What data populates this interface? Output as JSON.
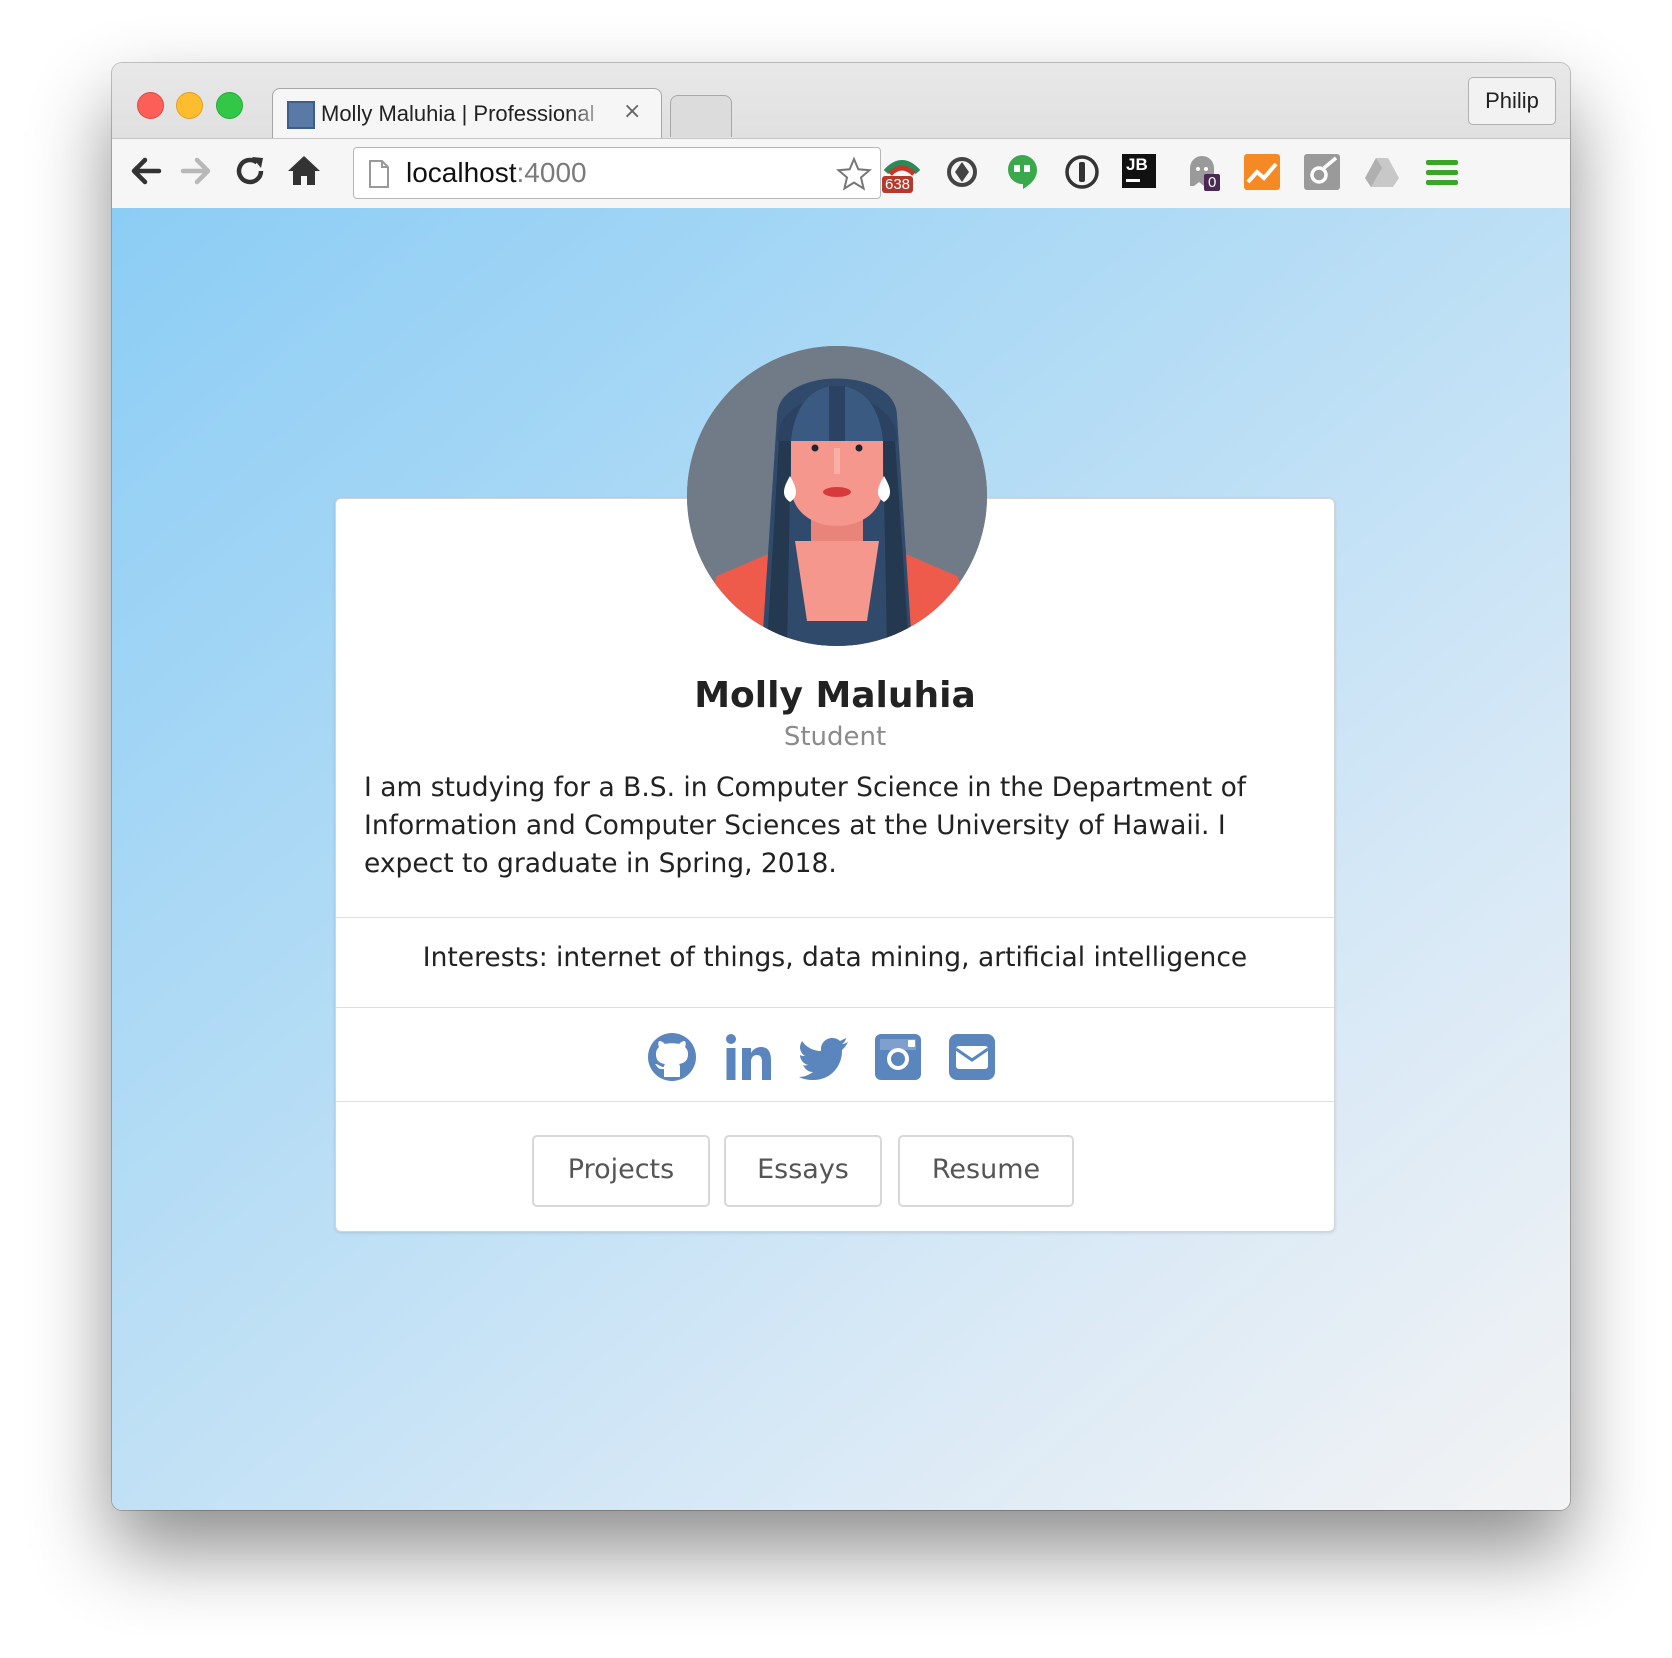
{
  "browser": {
    "tab_title": "Molly Maluhia | Professional",
    "tab_close": "×",
    "profile_name": "Philip",
    "url_host": "localhost",
    "url_port": ":4000",
    "extensions": [
      {
        "name": "clipper-icon",
        "badge": "638"
      },
      {
        "name": "sync-icon"
      },
      {
        "name": "hangouts-icon"
      },
      {
        "name": "1password-icon"
      },
      {
        "name": "jetbrains-icon",
        "label": "JB"
      },
      {
        "name": "ghostery-icon",
        "badge": "0"
      },
      {
        "name": "analytics-icon"
      },
      {
        "name": "meteor-icon"
      },
      {
        "name": "drive-icon"
      },
      {
        "name": "menu-icon"
      }
    ]
  },
  "profile": {
    "name": "Molly Maluhia",
    "role": "Student",
    "description": "I am studying for a B.S. in Computer Science in the Department of Information and Computer Sciences at the University of Hawaii. I expect to graduate in Spring, 2018.",
    "interests": "Interests: internet of things, data mining, artificial intelligence",
    "social": [
      "github-icon",
      "linkedin-icon",
      "twitter-icon",
      "instagram-icon",
      "email-icon"
    ],
    "buttons": {
      "projects": "Projects",
      "essays": "Essays",
      "resume": "Resume"
    }
  },
  "colors": {
    "accent": "#5b86bd",
    "background_start": "#8ccdf5",
    "background_end": "#f3f3f4"
  }
}
